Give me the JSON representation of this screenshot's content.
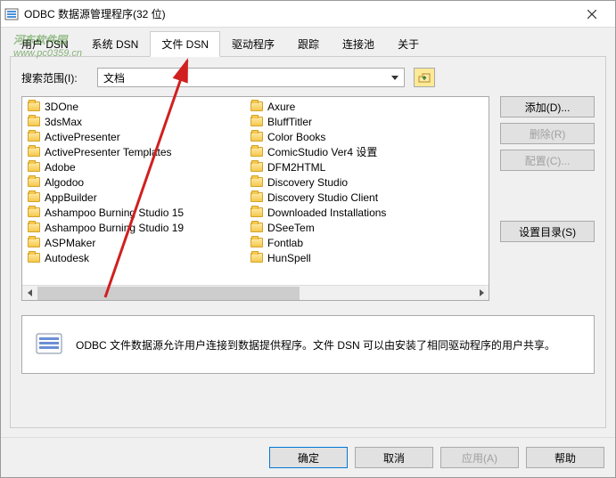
{
  "window": {
    "title": "ODBC 数据源管理程序(32 位)"
  },
  "tabs": {
    "items": [
      {
        "label": "用户 DSN"
      },
      {
        "label": "系统 DSN"
      },
      {
        "label": "文件 DSN"
      },
      {
        "label": "驱动程序"
      },
      {
        "label": "跟踪"
      },
      {
        "label": "连接池"
      },
      {
        "label": "关于"
      }
    ],
    "activeIndex": 2
  },
  "search": {
    "label": "搜索范围(I):",
    "value": "文档"
  },
  "folders": {
    "col1": [
      "3DOne",
      "3dsMax",
      "ActivePresenter",
      "ActivePresenter Templates",
      "Adobe",
      "Algodoo",
      "AppBuilder",
      "Ashampoo Burning Studio 15",
      "Ashampoo Burning Studio 19",
      "ASPMaker",
      "Autodesk"
    ],
    "col2": [
      "Axure",
      "BluffTitler",
      "Color Books",
      "ComicStudio Ver4 设置",
      "DFM2HTML",
      "Discovery Studio",
      "Discovery Studio Client",
      "Downloaded Installations",
      "DSeeTem",
      "Fontlab",
      "HunSpell"
    ]
  },
  "actions": {
    "add": "添加(D)...",
    "delete": "删除(R)",
    "configure": "配置(C)...",
    "setdir": "设置目录(S)"
  },
  "info": {
    "text": "ODBC 文件数据源允许用户连接到数据提供程序。文件 DSN 可以由安装了相同驱动程序的用户共享。"
  },
  "buttons": {
    "ok": "确定",
    "cancel": "取消",
    "apply": "应用(A)",
    "help": "帮助"
  },
  "watermark": {
    "brand": "河东软件园",
    "url": "www.pc0359.cn"
  }
}
